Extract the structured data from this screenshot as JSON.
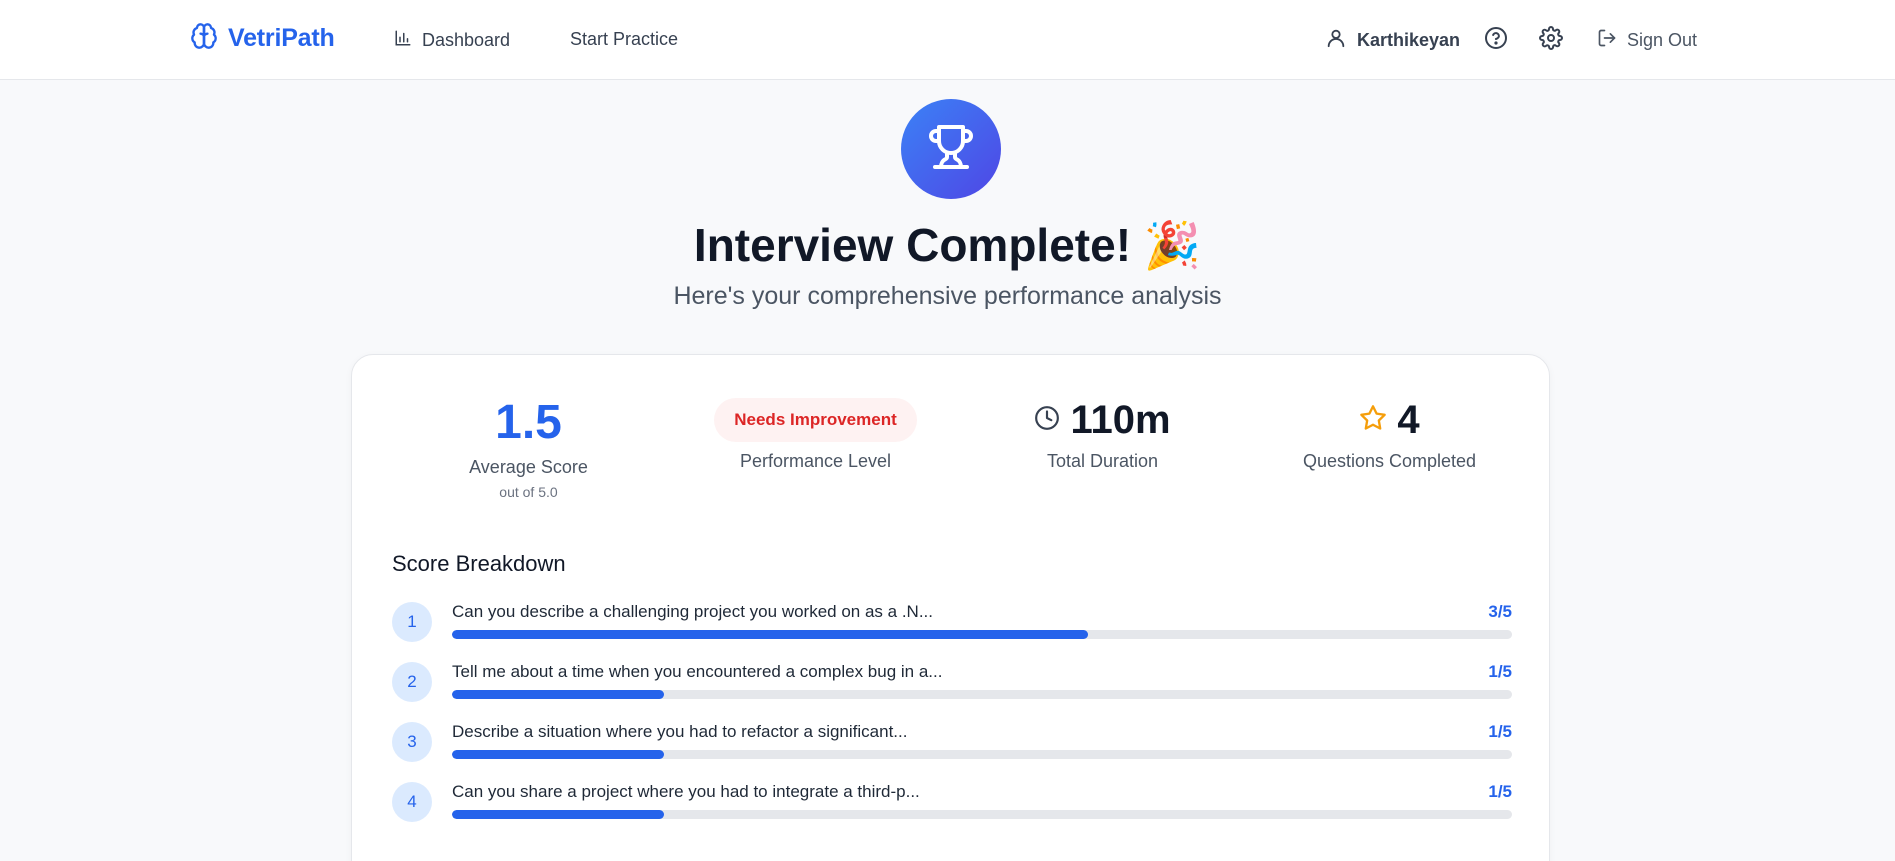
{
  "nav": {
    "brand": "VetriPath",
    "dashboard": "Dashboard",
    "start_practice": "Start Practice",
    "user_name": "Karthikeyan",
    "sign_out": "Sign Out"
  },
  "hero": {
    "title": "Interview Complete! 🎉",
    "subtitle": "Here's your comprehensive performance analysis"
  },
  "stats": {
    "average_score": "1.5",
    "average_label": "Average Score",
    "average_sub": "out of 5.0",
    "performance_badge": "Needs Improvement",
    "performance_label": "Performance Level",
    "duration": "110m",
    "duration_label": "Total Duration",
    "questions": "4",
    "questions_label": "Questions Completed"
  },
  "breakdown": {
    "title": "Score Breakdown",
    "items": [
      {
        "num": "1",
        "text": "Can you describe a challenging project you worked on as a .N...",
        "score": "3/5",
        "fraction": 0.6
      },
      {
        "num": "2",
        "text": "Tell me about a time when you encountered a complex bug in a...",
        "score": "1/5",
        "fraction": 0.2
      },
      {
        "num": "3",
        "text": "Describe a situation where you had to refactor a significant...",
        "score": "1/5",
        "fraction": 0.2
      },
      {
        "num": "4",
        "text": "Can you share a project where you had to integrate a third-p...",
        "score": "1/5",
        "fraction": 0.2
      }
    ]
  },
  "colors": {
    "accent": "#2563eb",
    "badge_text": "#dc2626",
    "badge_bg": "#fef2f2",
    "star": "#f59e0b"
  }
}
